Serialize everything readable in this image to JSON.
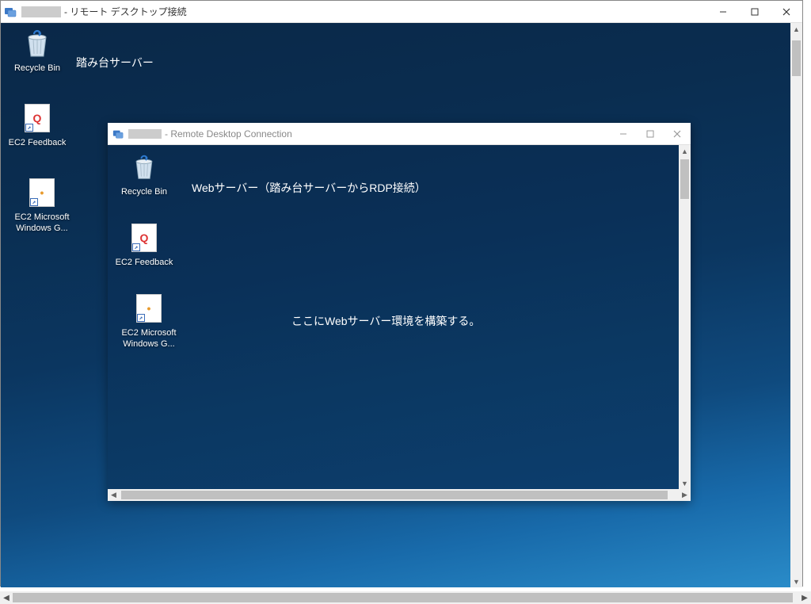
{
  "outer_window": {
    "title_suffix": "- リモート デスクトップ接続",
    "label": "踏み台サーバー",
    "icons": {
      "recycle": "Recycle Bin",
      "ec2_feedback": "EC2 Feedback",
      "ec2_win_guide": "EC2 Microsoft Windows G..."
    }
  },
  "inner_window": {
    "title_suffix": "- Remote Desktop Connection",
    "label_line1": "Webサーバー（踏み台サーバーからRDP接続）",
    "label_line2": "ここにWebサーバー環境を構築する。",
    "icons": {
      "recycle": "Recycle Bin",
      "ec2_feedback": "EC2 Feedback",
      "ec2_win_guide": "EC2 Microsoft Windows G..."
    }
  },
  "doc_glyphs": {
    "q": "Q",
    "dot": "•"
  }
}
